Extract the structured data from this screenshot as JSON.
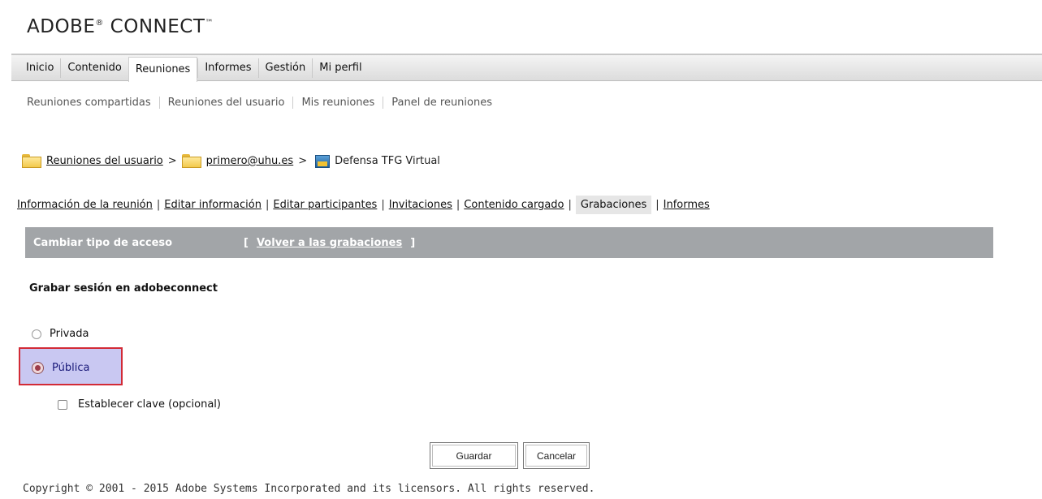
{
  "logo": {
    "text": "ADOBE",
    "reg": "®",
    "text2": " CONNECT",
    "tm": "™"
  },
  "topnav": {
    "tabs": [
      {
        "label": "Inicio"
      },
      {
        "label": "Contenido"
      },
      {
        "label": "Reuniones",
        "active": true
      },
      {
        "label": "Informes"
      },
      {
        "label": "Gestión"
      },
      {
        "label": "Mi perfil"
      }
    ]
  },
  "subnav": {
    "items": [
      "Reuniones compartidas",
      "Reuniones del usuario",
      "Mis reuniones",
      "Panel de reuniones"
    ]
  },
  "breadcrumb": {
    "root": "Reuniones del usuario",
    "sep": ">",
    "folder": "primero@uhu.es",
    "meeting": "Defensa TFG Virtual"
  },
  "meeting_tabs": {
    "items": [
      "Información de la reunión",
      "Editar información",
      "Editar participantes",
      "Invitaciones",
      "Contenido cargado",
      "Grabaciones",
      "Informes"
    ],
    "sep": "|"
  },
  "panel": {
    "title": "Cambiar tipo de acceso",
    "open_bracket": "[",
    "back_link": "Volver a las grabaciones",
    "close_bracket": "]"
  },
  "form": {
    "section_title": "Grabar sesión en adobeconnect",
    "option_private": "Privada",
    "option_public": "Pública",
    "selected": "Pública",
    "password_checkbox": "Establecer clave (opcional)",
    "password_checked": false
  },
  "buttons": {
    "save": "Guardar",
    "cancel": "Cancelar"
  },
  "footer": {
    "copyright": "Copyright © 2001 - 2015 Adobe Systems Incorporated and its licensors. All rights reserved."
  },
  "colors": {
    "panel_bar": "#a2a5a8",
    "highlight_border": "#d22b36",
    "highlight_fill": "#c9c8f2"
  },
  "icons": {
    "folder": "folder-icon",
    "meeting": "meeting-icon"
  }
}
